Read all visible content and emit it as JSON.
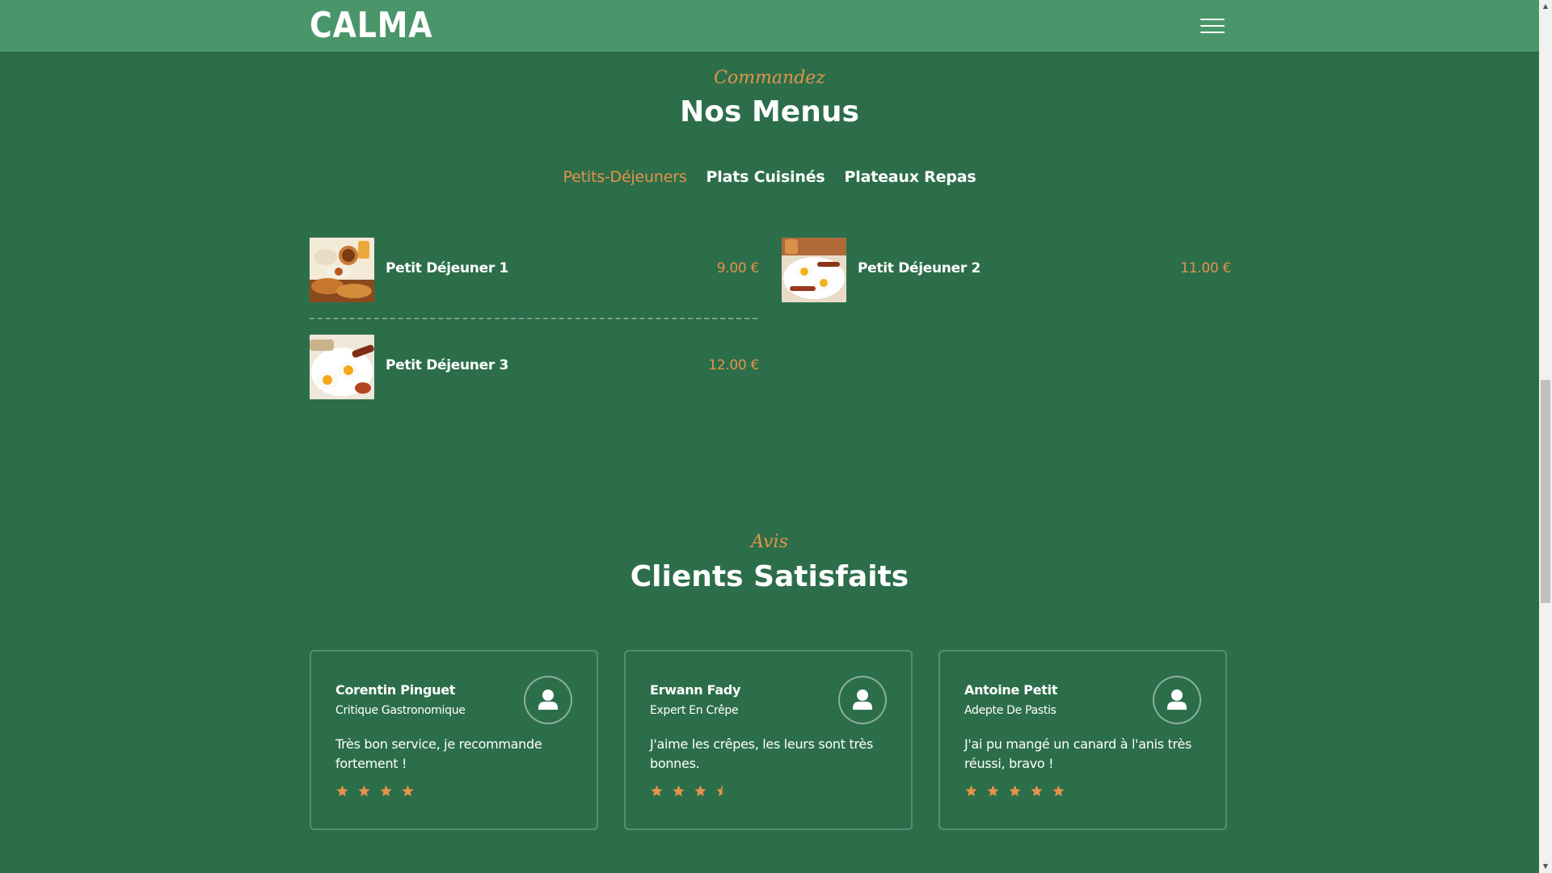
{
  "header": {
    "logo": "CALMA",
    "menu_icon": "hamburger-menu-icon"
  },
  "menus_section": {
    "eyebrow": "Commandez",
    "title": "Nos Menus",
    "tabs": [
      {
        "label": "Petits-Déjeuners",
        "active": true
      },
      {
        "label": "Plats Cuisinés",
        "active": false
      },
      {
        "label": "Plateaux Repas",
        "active": false
      }
    ],
    "items": [
      {
        "name": "Petit Déjeuner 1",
        "price": "9.00 €",
        "image": "breakfast-pastries-photo"
      },
      {
        "name": "Petit Déjeuner 2",
        "price": "11.00 €",
        "image": "breakfast-eggs-bacon-photo"
      },
      {
        "name": "Petit Déjeuner 3",
        "price": "12.00 €",
        "image": "breakfast-eggs-sausage-photo"
      }
    ]
  },
  "reviews_section": {
    "eyebrow": "Avis",
    "title": "Clients Satisfaits",
    "reviews": [
      {
        "name": "Corentin Pinguet",
        "role": "Critique Gastronomique",
        "text": "Très bon service, je recommande fortement !",
        "rating": 4
      },
      {
        "name": "Erwann Fady",
        "role": "Expert En Crêpe",
        "text": "J'aime les crêpes, les leurs sont très bonnes.",
        "rating": 3.5
      },
      {
        "name": "Antoine Petit",
        "role": "Adepte De Pastis",
        "text": "J'ai pu mangé un canard à l'anis très réussi, bravo !",
        "rating": 5
      }
    ]
  },
  "colors": {
    "background": "#2c6e4a",
    "header": "#4a966b",
    "accent": "#e4934a",
    "text": "#ffffff"
  },
  "icons": {
    "avatar": "user-icon",
    "star": "star-icon",
    "half_star": "star-half-icon"
  }
}
